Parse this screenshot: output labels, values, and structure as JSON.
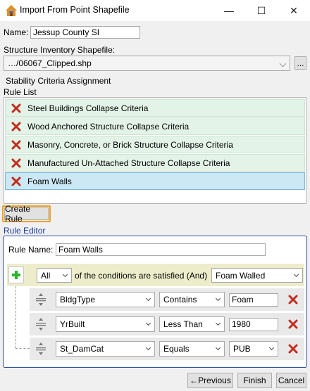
{
  "window": {
    "title": "Import From Point Shapefile",
    "minimize_glyph": "—",
    "maximize_glyph": "☐",
    "close_glyph": "✕"
  },
  "name": {
    "label": "Name:",
    "value": "Jessup County SI"
  },
  "shapefile": {
    "label": "Structure Inventory Shapefile:",
    "value": "…/06067_Clipped.shp",
    "browse_label": "..."
  },
  "stability": {
    "title": "Stability Criteria Assignment",
    "rule_list_label": "Rule List",
    "rules": [
      "Steel Buildings Collapse Criteria",
      "Wood Anchored Structure Collapse Criteria",
      "Masonry, Concrete, or Brick Structure Collapse Criteria",
      "Manufactured Un-Attached Structure Collapse Criteria",
      "Foam Walls"
    ],
    "create_rule_label": "Create Rule"
  },
  "editor": {
    "title": "Rule Editor",
    "rule_name_label": "Rule Name:",
    "rule_name_value": "Foam Walls",
    "quantifier": "All",
    "conditions_text": "of the conditions are satisfied (And)",
    "result": "Foam Walled",
    "conditions": [
      {
        "field": "BldgType",
        "operator": "Contains",
        "value": "Foam",
        "value_type": "text"
      },
      {
        "field": "YrBuilt",
        "operator": "Less Than",
        "value": "1980",
        "value_type": "text"
      },
      {
        "field": "St_DamCat",
        "operator": "Equals",
        "value": "PUB",
        "value_type": "combo"
      }
    ]
  },
  "footer": {
    "previous_label": "←Previous",
    "finish_label": "Finish",
    "cancel_label": "Cancel"
  },
  "colors": {
    "accent_orange": "#f0a020",
    "green_plus": "#2bb52b",
    "red_x": "#c42b1c",
    "group_blue": "#1a3d9c"
  }
}
